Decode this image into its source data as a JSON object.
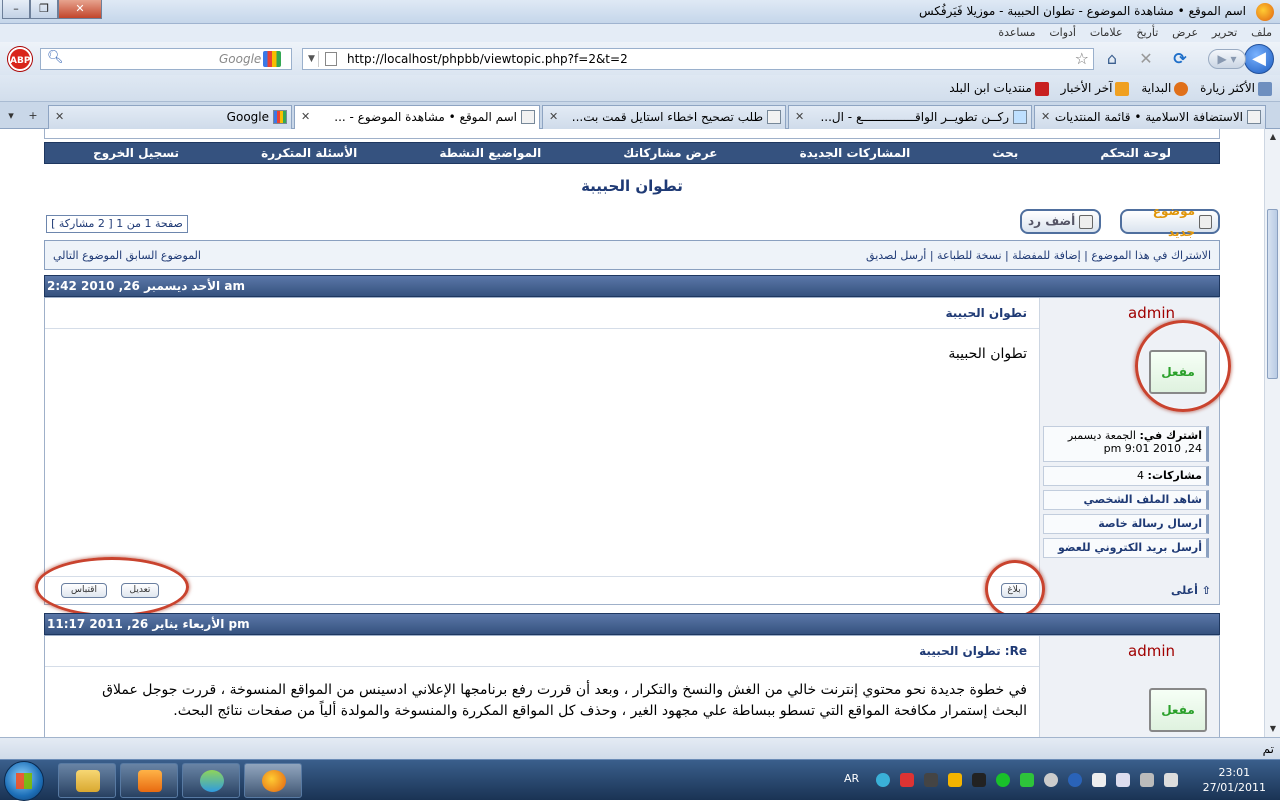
{
  "window": {
    "title": "اسم الموقع • مشاهدة الموضوع - تطوان الحبيبة - موزيلا فَيَرفُكس",
    "buttons": {
      "minimize": "–",
      "maximize": "❐",
      "close": "✕"
    }
  },
  "menu": [
    "ملف",
    "تحرير",
    "عرض",
    "تأريخ",
    "علامات",
    "أدوات",
    "مساعدة"
  ],
  "navigation": {
    "url": "http://localhost/phpbb/viewtopic.php?f=2&t=2",
    "search_placeholder": "Google",
    "abp_label": "ABP"
  },
  "bookmarks": [
    "الأكثر زيارة",
    "البداية",
    "آخر الأخبار",
    "منتديات ابن البلد"
  ],
  "tabs": [
    {
      "label": "الاستضافة الاسلامية • قائمة المنتديات",
      "active": false
    },
    {
      "label": "ركــن تطويــر الواقـــــــــــــــع - ال...",
      "active": false
    },
    {
      "label": "طلب تصحيح اخطاء استايل قمت بت...",
      "active": false
    },
    {
      "label": "اسم الموقع • مشاهدة الموضوع - ...",
      "active": true
    },
    {
      "label": "Google",
      "active": false
    }
  ],
  "forum": {
    "nav_links": [
      "لوحة التحكم",
      "بحث",
      "المشاركات الجديدة",
      "عرض مشاركاتك",
      "المواضيع النشطة",
      "الأسئلة المتكررة",
      "تسجيل الخروج"
    ],
    "topic_title": "تطوان الحبيبة",
    "page_info": "صفحة 1 من 1   [ 2 مشاركة ]",
    "buttons": {
      "new_topic": "موضوع جديد",
      "reply": "أضف رد"
    },
    "topic_options": "الاشتراك في هذا الموضوع | إضافة للمفضلة | نسخة للطباعة | أرسل لصديق",
    "prev_next": "الموضوع السابق   الموضوع التالي",
    "posts": [
      {
        "date": "الأحد ديسمبر 26, 2010 2:42 am",
        "author": "admin",
        "rank": "مفعل",
        "subject": "تطوان الحبيبة",
        "message": "تطوان الحبيبة",
        "profile": {
          "joined_label": "اشترك في:",
          "joined_value": "الجمعة ديسمبر 24, 2010 9:01 pm",
          "posts_label": "مشاركات:",
          "posts_value": "4",
          "view_profile": "شاهد الملف الشخصي",
          "send_pm": "ارسال رسالة خاصة",
          "send_email": "أرسل بريد الكتروني للعضو"
        },
        "actions": {
          "quote": "اقتباس",
          "edit": "تعديل",
          "report": "بلاغ",
          "top": "أعلى"
        }
      },
      {
        "date": "الأربعاء يناير 26, 2011 11:17 pm",
        "author": "admin",
        "rank": "مفعل",
        "subject": "Re: تطوان الحبيبة",
        "message": "في خطوة جديدة نحو محتوي إنترنت خالي من الغش والنسخ والتكرار ، وبعد أن قررت رفع برنامجها الإعلاني ادسينس من المواقع المنسوخة ، قررت جوجل عملاق البحث إستمرار مكافحة المواقع التي تسطو ببساطة علي مجهود الغير ، وحذف كل المواقع المكررة والمنسوخة والمولدة ألياً من صفحات نتائج البحث."
      }
    ]
  },
  "status": "تم",
  "taskbar": {
    "lang": "AR",
    "time": "23:01",
    "date": "27/01/2011"
  }
}
